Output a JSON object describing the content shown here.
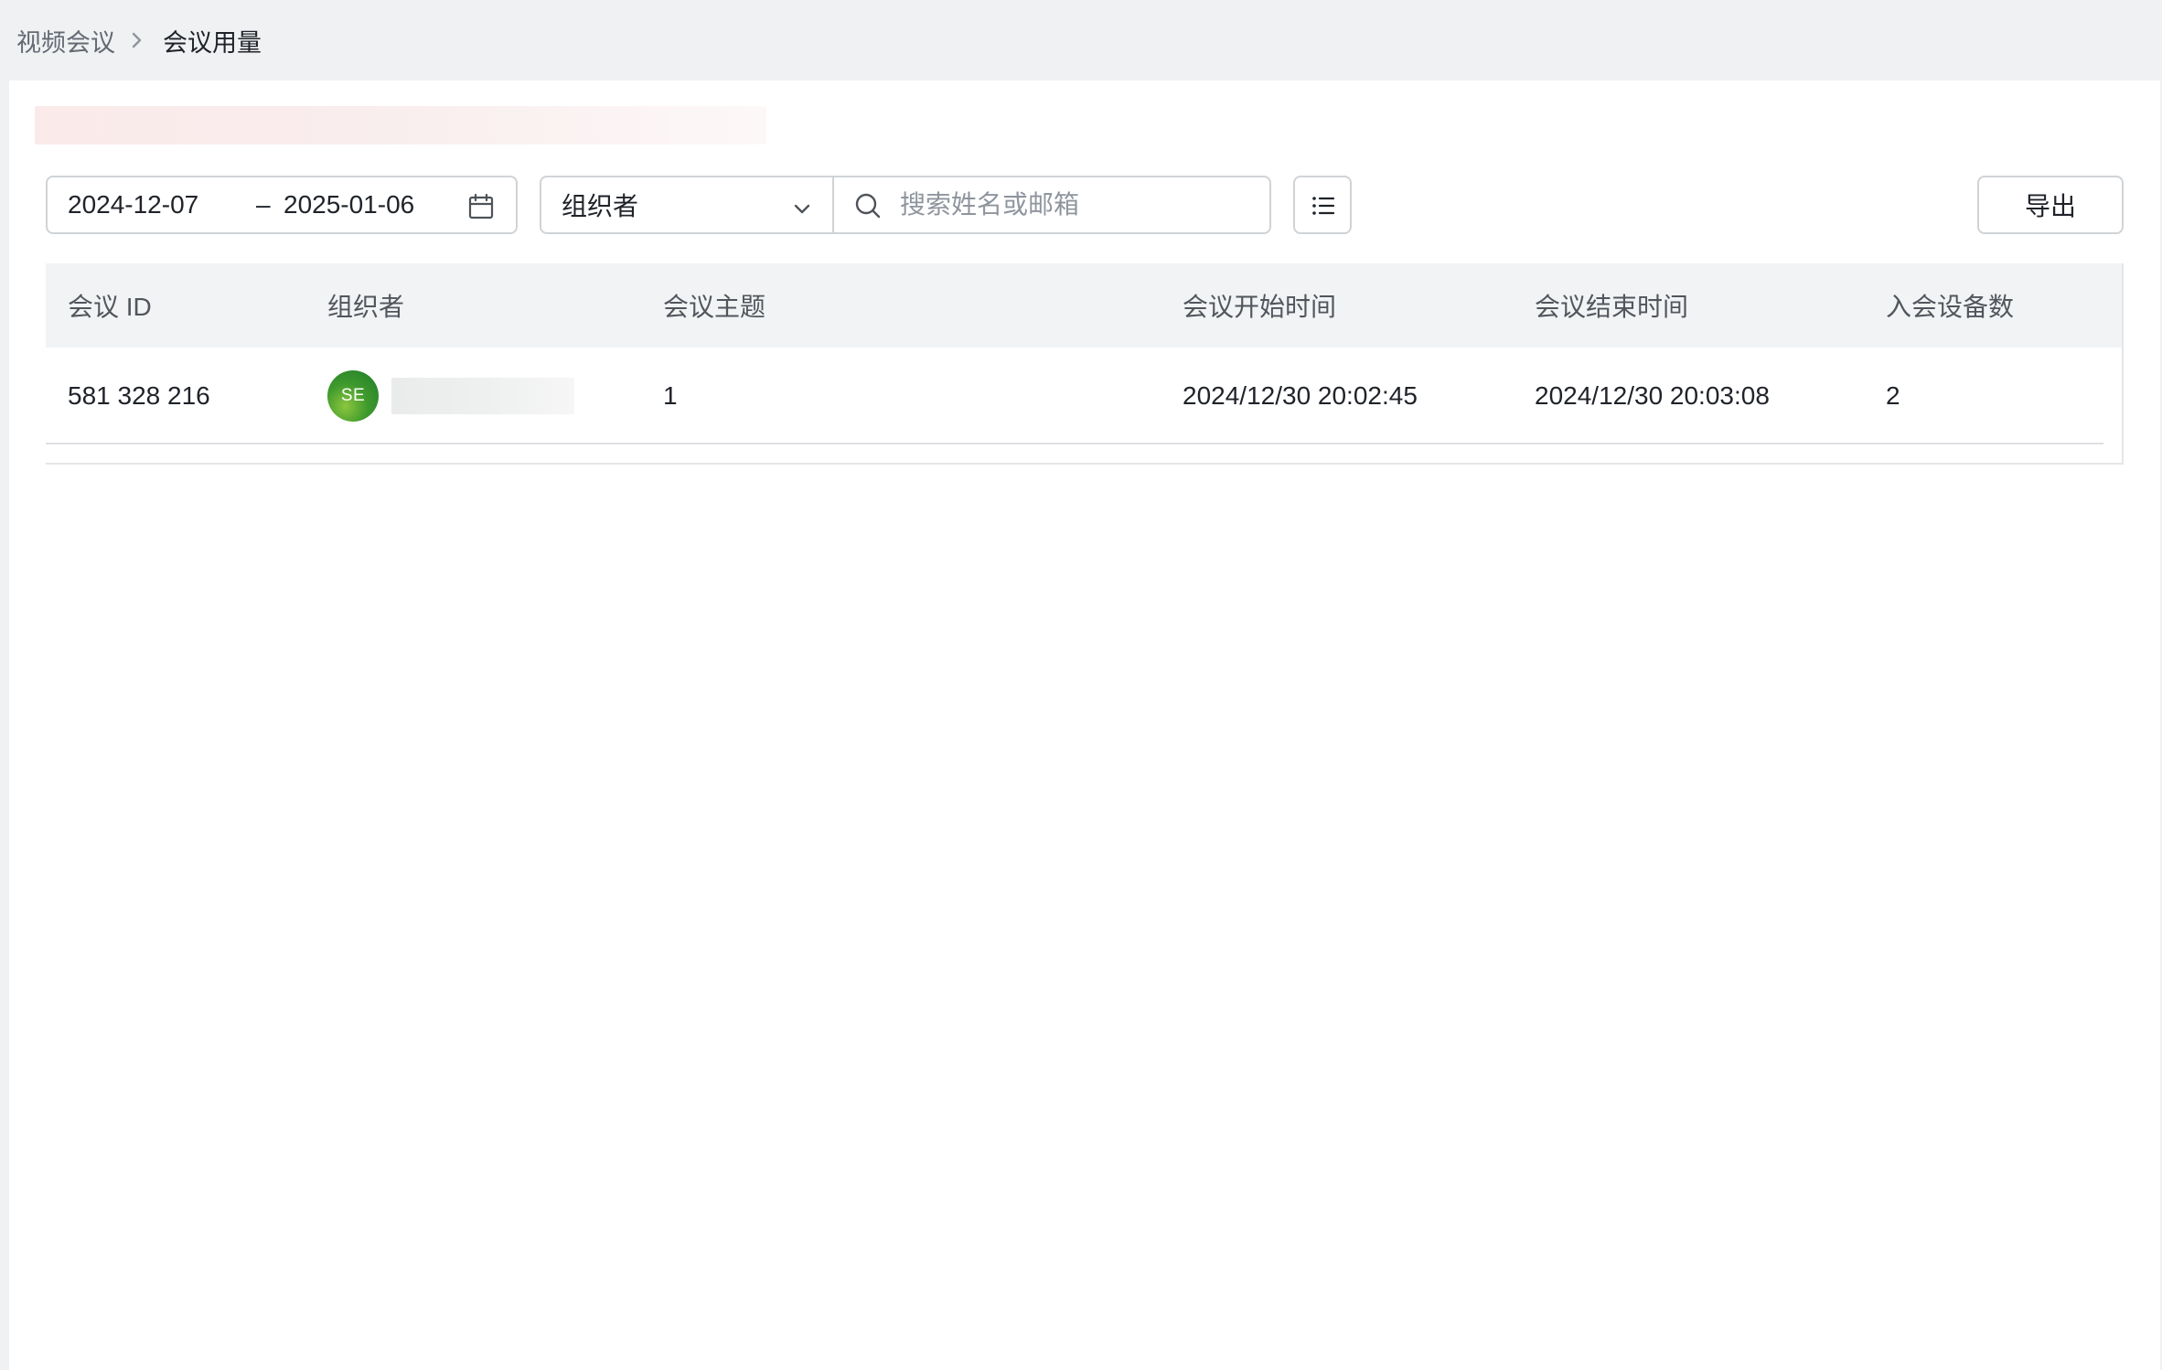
{
  "breadcrumb": {
    "parent": "视频会议",
    "current": "会议用量"
  },
  "filters": {
    "date_start": "2024-12-07",
    "date_separator": "–",
    "date_end": "2025-01-06",
    "organizer_select": "组织者",
    "search_placeholder": "搜索姓名或邮箱",
    "search_value": ""
  },
  "toolbar": {
    "export_label": "导出"
  },
  "table": {
    "columns": [
      "会议 ID",
      "组织者",
      "会议主题",
      "会议开始时间",
      "会议结束时间",
      "入会设备数"
    ],
    "rows": [
      {
        "meeting_id": "581 328 216",
        "organizer_initials": "SE",
        "topic": "1",
        "start_time": "2024/12/30 20:02:45",
        "end_time": "2024/12/30 20:03:08",
        "device_count": "2"
      }
    ]
  },
  "icons": {
    "breadcrumb_separator": "chevron-right-icon",
    "date_picker": "calendar-icon",
    "select_arrow": "chevron-down-icon",
    "search": "search-icon",
    "columns": "list-icon"
  },
  "colors": {
    "avatar_green": "#3f9a2c",
    "border": "#d0d3d6",
    "header_bg": "#f2f3f5"
  }
}
